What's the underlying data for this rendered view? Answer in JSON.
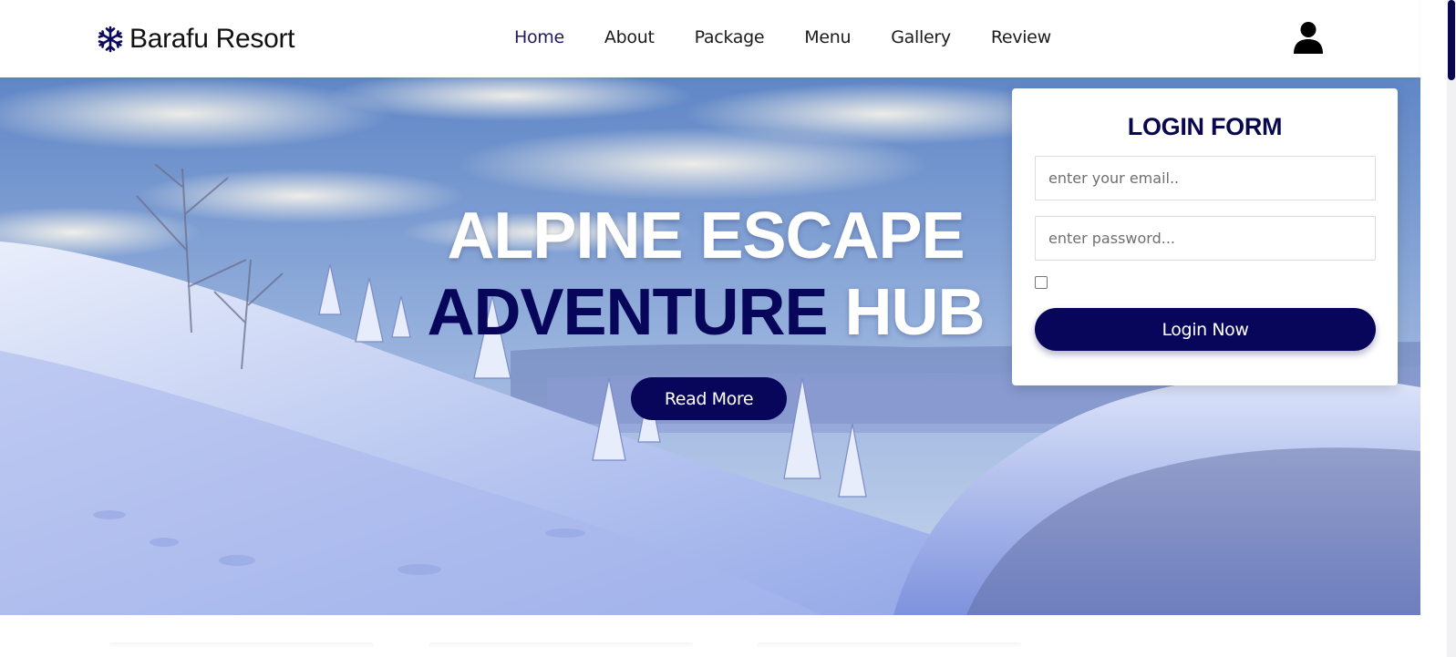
{
  "header": {
    "brand_name": "Barafu Resort",
    "brand_icon": "snowflake-icon",
    "nav": [
      {
        "label": "Home",
        "active": true
      },
      {
        "label": "About",
        "active": false
      },
      {
        "label": "Package",
        "active": false
      },
      {
        "label": "Menu",
        "active": false
      },
      {
        "label": "Gallery",
        "active": false
      },
      {
        "label": "Review",
        "active": false
      }
    ],
    "user_icon": "user-icon"
  },
  "hero": {
    "line1": "ALPINE ESCAPE",
    "line2_accent": "ADVENTURE",
    "line2_plain": "HUB",
    "button_label": "Read More"
  },
  "login_form": {
    "title": "LOGIN FORM",
    "email_placeholder": "enter your email..",
    "email_value": "",
    "password_placeholder": "enter password...",
    "password_value": "",
    "remember_checked": false,
    "submit_label": "Login Now"
  },
  "colors": {
    "brand_navy": "#07065a",
    "active_nav": "#1e1b63",
    "text_dark": "#1b1b1b",
    "white": "#ffffff"
  }
}
